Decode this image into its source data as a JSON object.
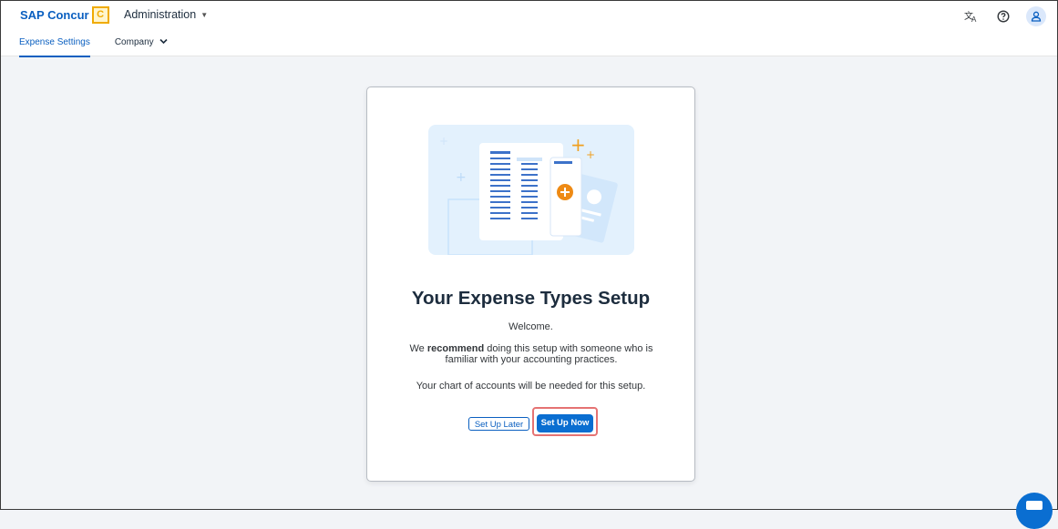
{
  "header": {
    "brand": "SAP Concur",
    "brand_logo_letter": "C",
    "menu_title": "Administration",
    "icons": [
      "translate-icon",
      "help-icon",
      "user-icon"
    ]
  },
  "tabs": [
    {
      "label": "Expense Settings",
      "active": true
    },
    {
      "label": "Company",
      "active": false
    }
  ],
  "card": {
    "title": "Your Expense Types Setup",
    "welcome": "Welcome.",
    "recommend_prefix": "We ",
    "recommend_bold": "recommend",
    "recommend_suffix": " doing this setup with someone who is familiar with your accounting practices.",
    "chart_note": "Your chart of accounts will be needed for this setup.",
    "btn_later": "Set Up Later",
    "btn_now": "Set Up Now"
  },
  "colors": {
    "brand_blue": "#0a5fc0",
    "button_blue": "#0a6ed1",
    "logo_gold": "#f0ab00",
    "highlight_red": "#e57373",
    "page_bg": "#f2f4f7"
  }
}
